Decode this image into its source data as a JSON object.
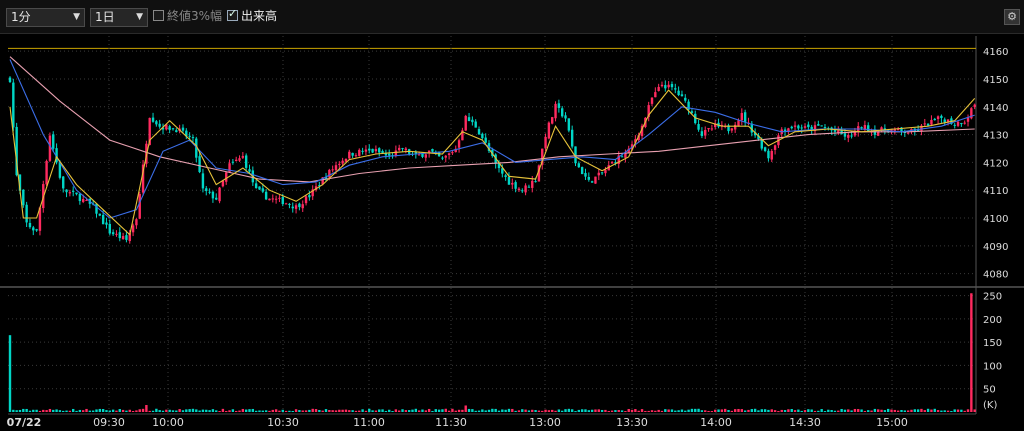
{
  "toolbar": {
    "interval": "1分",
    "period": "1日",
    "check_3pct": {
      "label": "終値3%幅",
      "checked": false
    },
    "check_volume": {
      "label": "出来高",
      "checked": true
    },
    "settings_icon": "gear-icon"
  },
  "chart_data": [
    {
      "type": "candlestick",
      "title": "",
      "y_ticks": [
        "4160",
        "4150",
        "4140",
        "4130",
        "4120",
        "4110",
        "4100",
        "4090",
        "4080"
      ],
      "ylim": [
        4077,
        4164
      ],
      "x_ticks": [
        "07/22",
        "09:30",
        "10:00",
        "10:30",
        "11:00",
        "11:30",
        "13:00",
        "13:30",
        "14:00",
        "14:30",
        "15:00"
      ],
      "reference_line": 4161,
      "close_path": [
        [
          0,
          4150
        ],
        [
          2,
          4115
        ],
        [
          5,
          4098
        ],
        [
          8,
          4095
        ],
        [
          12,
          4130
        ],
        [
          16,
          4110
        ],
        [
          20,
          4108
        ],
        [
          25,
          4104
        ],
        [
          30,
          4095
        ],
        [
          35,
          4092
        ],
        [
          38,
          4100
        ],
        [
          42,
          4137
        ],
        [
          45,
          4133
        ],
        [
          50,
          4132
        ],
        [
          55,
          4128
        ],
        [
          58,
          4110
        ],
        [
          62,
          4107
        ],
        [
          66,
          4119
        ],
        [
          70,
          4122
        ],
        [
          74,
          4110
        ],
        [
          78,
          4107
        ],
        [
          82,
          4106
        ],
        [
          86,
          4104
        ],
        [
          90,
          4108
        ],
        [
          94,
          4114
        ],
        [
          98,
          4119
        ],
        [
          102,
          4123
        ],
        [
          106,
          4124
        ],
        [
          110,
          4124
        ],
        [
          114,
          4122
        ],
        [
          118,
          4125
        ],
        [
          122,
          4122
        ],
        [
          126,
          4124
        ],
        [
          130,
          4121
        ],
        [
          134,
          4125
        ],
        [
          137,
          4136
        ],
        [
          140,
          4133
        ],
        [
          142,
          4129
        ],
        [
          146,
          4119
        ],
        [
          150,
          4113
        ],
        [
          154,
          4110
        ],
        [
          158,
          4114
        ],
        [
          161,
          4130
        ],
        [
          164,
          4140
        ],
        [
          167,
          4136
        ],
        [
          170,
          4120
        ],
        [
          174,
          4113
        ],
        [
          178,
          4116
        ],
        [
          182,
          4121
        ],
        [
          186,
          4124
        ],
        [
          190,
          4133
        ],
        [
          193,
          4143
        ],
        [
          196,
          4148
        ],
        [
          200,
          4146
        ],
        [
          204,
          4140
        ],
        [
          208,
          4130
        ],
        [
          212,
          4133
        ],
        [
          216,
          4132
        ],
        [
          220,
          4137
        ],
        [
          224,
          4130
        ],
        [
          228,
          4122
        ],
        [
          232,
          4132
        ],
        [
          236,
          4133
        ],
        [
          240,
          4132
        ],
        [
          244,
          4133
        ],
        [
          248,
          4131
        ],
        [
          252,
          4129
        ],
        [
          256,
          4133
        ],
        [
          260,
          4131
        ],
        [
          264,
          4132
        ],
        [
          268,
          4131
        ],
        [
          272,
          4131
        ],
        [
          276,
          4134
        ],
        [
          280,
          4136
        ],
        [
          284,
          4134
        ],
        [
          287,
          4135
        ],
        [
          290,
          4141
        ]
      ],
      "ma_short": [
        [
          0,
          4140
        ],
        [
          4,
          4100
        ],
        [
          8,
          4100
        ],
        [
          14,
          4122
        ],
        [
          20,
          4112
        ],
        [
          28,
          4103
        ],
        [
          36,
          4094
        ],
        [
          42,
          4128
        ],
        [
          48,
          4135
        ],
        [
          56,
          4126
        ],
        [
          62,
          4112
        ],
        [
          70,
          4118
        ],
        [
          78,
          4110
        ],
        [
          86,
          4106
        ],
        [
          94,
          4112
        ],
        [
          102,
          4121
        ],
        [
          110,
          4123
        ],
        [
          120,
          4124
        ],
        [
          130,
          4123
        ],
        [
          136,
          4131
        ],
        [
          142,
          4128
        ],
        [
          150,
          4115
        ],
        [
          158,
          4114
        ],
        [
          164,
          4133
        ],
        [
          170,
          4122
        ],
        [
          178,
          4117
        ],
        [
          186,
          4122
        ],
        [
          192,
          4137
        ],
        [
          198,
          4146
        ],
        [
          206,
          4136
        ],
        [
          214,
          4133
        ],
        [
          222,
          4133
        ],
        [
          228,
          4126
        ],
        [
          236,
          4131
        ],
        [
          246,
          4132
        ],
        [
          256,
          4131
        ],
        [
          266,
          4132
        ],
        [
          276,
          4133
        ],
        [
          284,
          4135
        ],
        [
          290,
          4143
        ]
      ],
      "ma_mid": [
        [
          0,
          4157
        ],
        [
          10,
          4130
        ],
        [
          20,
          4110
        ],
        [
          30,
          4100
        ],
        [
          38,
          4103
        ],
        [
          46,
          4124
        ],
        [
          54,
          4128
        ],
        [
          62,
          4118
        ],
        [
          72,
          4116
        ],
        [
          82,
          4112
        ],
        [
          92,
          4113
        ],
        [
          102,
          4119
        ],
        [
          112,
          4122
        ],
        [
          122,
          4123
        ],
        [
          132,
          4124
        ],
        [
          142,
          4127
        ],
        [
          152,
          4120
        ],
        [
          162,
          4121
        ],
        [
          172,
          4122
        ],
        [
          182,
          4121
        ],
        [
          192,
          4130
        ],
        [
          202,
          4140
        ],
        [
          212,
          4138
        ],
        [
          222,
          4134
        ],
        [
          232,
          4131
        ],
        [
          244,
          4132
        ],
        [
          256,
          4132
        ],
        [
          268,
          4131
        ],
        [
          280,
          4133
        ],
        [
          290,
          4137
        ]
      ],
      "ma_long": [
        [
          0,
          4158
        ],
        [
          15,
          4142
        ],
        [
          30,
          4128
        ],
        [
          45,
          4122
        ],
        [
          60,
          4118
        ],
        [
          75,
          4114
        ],
        [
          90,
          4113
        ],
        [
          105,
          4116
        ],
        [
          120,
          4118
        ],
        [
          135,
          4119
        ],
        [
          150,
          4120
        ],
        [
          165,
          4122
        ],
        [
          180,
          4123
        ],
        [
          195,
          4124
        ],
        [
          210,
          4126
        ],
        [
          225,
          4128
        ],
        [
          240,
          4130
        ],
        [
          255,
          4131
        ],
        [
          270,
          4131
        ],
        [
          290,
          4132
        ]
      ]
    },
    {
      "type": "bar",
      "title": "",
      "ylabel": "(K)",
      "y_ticks": [
        "250",
        "200",
        "150",
        "100",
        "50"
      ],
      "ylim": [
        0,
        262
      ],
      "spikes": [
        [
          0,
          165
        ],
        [
          41,
          15
        ],
        [
          137,
          14
        ],
        [
          289,
          255
        ]
      ]
    }
  ]
}
